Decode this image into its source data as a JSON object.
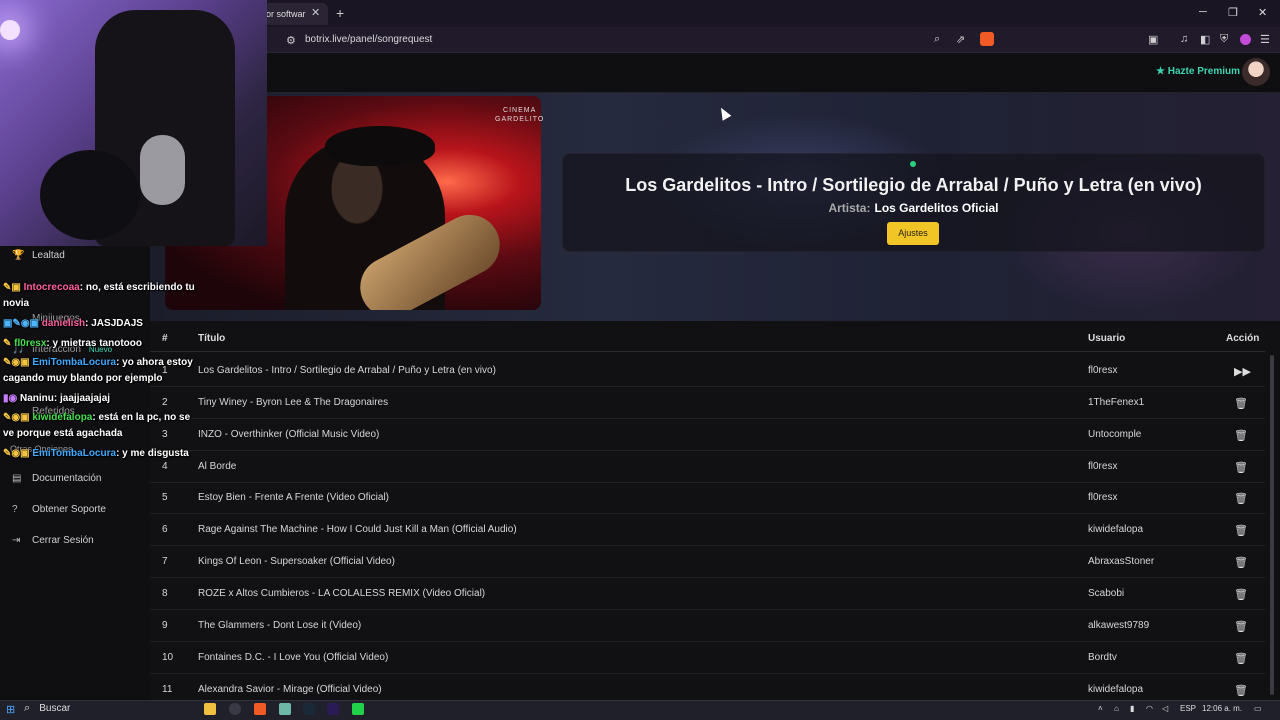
{
  "browser": {
    "tab_title": "or softwar",
    "url": "botrix.live/panel/songrequest",
    "new_tab_icon": "plus-icon",
    "win_min": "─",
    "win_max": "❐",
    "win_close": "✕"
  },
  "topbar": {
    "premium_label": "Hazte Premium"
  },
  "now_playing": {
    "title": "Los Gardelitos - Intro / Sortilegio de Arrabal / Puño y Letra (en vivo)",
    "artist_label": "Artista:",
    "artist": "Los Gardelitos Oficial",
    "settings_button": "Ajustes",
    "video_watermark_line1": "CINEMA",
    "video_watermark_line2": "GARDELITO"
  },
  "table": {
    "headers": {
      "num": "#",
      "title": "Título",
      "user": "Usuario",
      "action": "Acción"
    },
    "rows": [
      {
        "num": "1",
        "title": "Los Gardelitos - Intro / Sortilegio de Arrabal / Puño y Letra (en vivo)",
        "user": "fl0resx",
        "action": "▶▶"
      },
      {
        "num": "2",
        "title": "Tiny Winey - Byron Lee & The Dragonaires",
        "user": "1TheFenex1",
        "action": "🗑"
      },
      {
        "num": "3",
        "title": "INZO - Overthinker (Official Music Video)",
        "user": "Untocomple",
        "action": "🗑"
      },
      {
        "num": "4",
        "title": "Al Borde",
        "user": "fl0resx",
        "action": "🗑"
      },
      {
        "num": "5",
        "title": "Estoy Bien - Frente A Frente (Video Oficial)",
        "user": "fl0resx",
        "action": "🗑"
      },
      {
        "num": "6",
        "title": "Rage Against The Machine - How I Could Just Kill a Man (Official Audio)",
        "user": "kiwidefalopa",
        "action": "🗑"
      },
      {
        "num": "7",
        "title": "Kings Of Leon - Supersoaker (Official Video)",
        "user": "AbraxasStoner",
        "action": "🗑"
      },
      {
        "num": "8",
        "title": "ROZE x Altos Cumbieros - LA COLALESS REMIX (Video Oficial)",
        "user": "Scabobi",
        "action": "🗑"
      },
      {
        "num": "9",
        "title": "The Glammers - Dont Lose it (Video)",
        "user": "alkawest9789",
        "action": "🗑"
      },
      {
        "num": "10",
        "title": "Fontaines D.C. - I Love You (Official Video)",
        "user": "Bordtv",
        "action": "🗑"
      },
      {
        "num": "11",
        "title": "Alexandra Savior - Mirage (Official Video)",
        "user": "kiwidefalopa",
        "action": "🗑"
      }
    ]
  },
  "sidebar": {
    "items": [
      {
        "label": "Lealtad",
        "icon": "🏆"
      },
      {
        "label": "Minijuegos",
        "icon": ""
      },
      {
        "label": "Interacción",
        "icon": "🎵"
      },
      {
        "label": "Referidos",
        "icon": ""
      },
      {
        "label": "Otras Opciones",
        "icon": ""
      },
      {
        "label": "Documentación",
        "icon": "▤"
      },
      {
        "label": "Obtener Soporte",
        "icon": "?"
      },
      {
        "label": "Cerrar Sesión",
        "icon": "⇥"
      }
    ],
    "badge_new": "Nuevo"
  },
  "chat": [
    {
      "user": "Intocrecoaa",
      "text": ": no, está escribiendo tu novia",
      "color": "#ff5f9e"
    },
    {
      "user": "danielish",
      "text": ": JASJDAJS",
      "color": "#ff5f9e"
    },
    {
      "user": "fl0resx",
      "text": ": y mietras tanotooo",
      "color": "#46e04e"
    },
    {
      "user": "EmiTombaLocura",
      "text": ": yo ahora estoy cagando muy blando por ejemplo",
      "color": "#3fa9ff"
    },
    {
      "user": "Naninu",
      "text": ": jaajjaajajaj",
      "color": "#ffffff"
    },
    {
      "user": "kiwidefalopa",
      "text": ": está en la pc, no se ve porque está agachada",
      "color": "#46e04e"
    },
    {
      "user": "EmiTombaLocura",
      "text": ": y me disgusta",
      "color": "#3fa9ff"
    }
  ],
  "taskbar": {
    "search_placeholder": "Buscar",
    "lang": "ESP",
    "time": "12:06 a. m."
  },
  "colors": {
    "accent_yellow": "#f2c526",
    "premium_teal": "#3ed3b0",
    "live_green": "#29d17c"
  }
}
